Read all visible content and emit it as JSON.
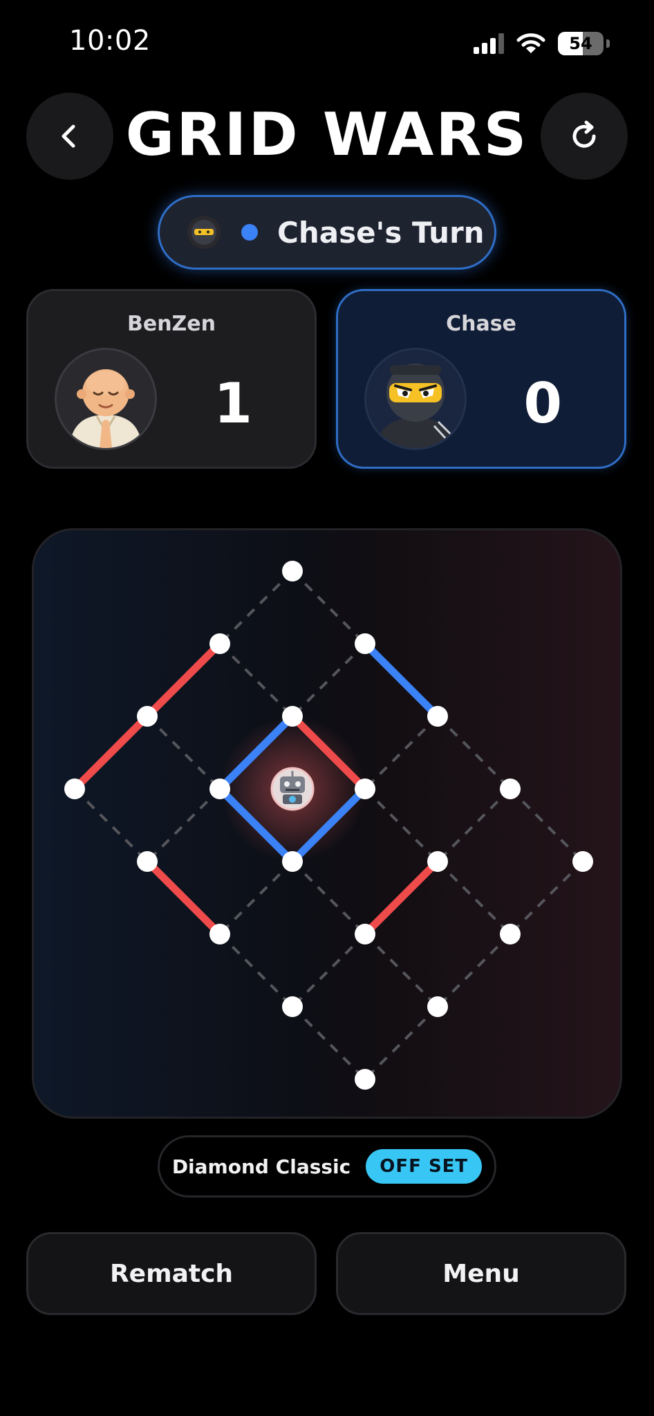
{
  "status_bar": {
    "time": "10:02",
    "battery": "54"
  },
  "header": {
    "title": "GRID WARS",
    "back_icon": "chevron-left-icon",
    "refresh_icon": "refresh-icon"
  },
  "turn": {
    "label": "Chase's Turn",
    "avatar_icon": "ninja-avatar-icon",
    "color": "#3b82f6"
  },
  "players": [
    {
      "name": "BenZen",
      "score": "1",
      "avatar": "monk-avatar-icon",
      "color": "#ef4444"
    },
    {
      "name": "Chase",
      "score": "0",
      "avatar": "ninja-avatar-icon",
      "color": "#3b82f6"
    }
  ],
  "board": {
    "colors": {
      "player1": "#ef4444",
      "player2": "#3b82f6",
      "undrawn": "#555555"
    },
    "claimed_box_icon": "robot-icon"
  },
  "mode": {
    "name": "Diamond Classic",
    "badge": "OFF SET"
  },
  "actions": {
    "rematch": "Rematch",
    "menu": "Menu"
  }
}
